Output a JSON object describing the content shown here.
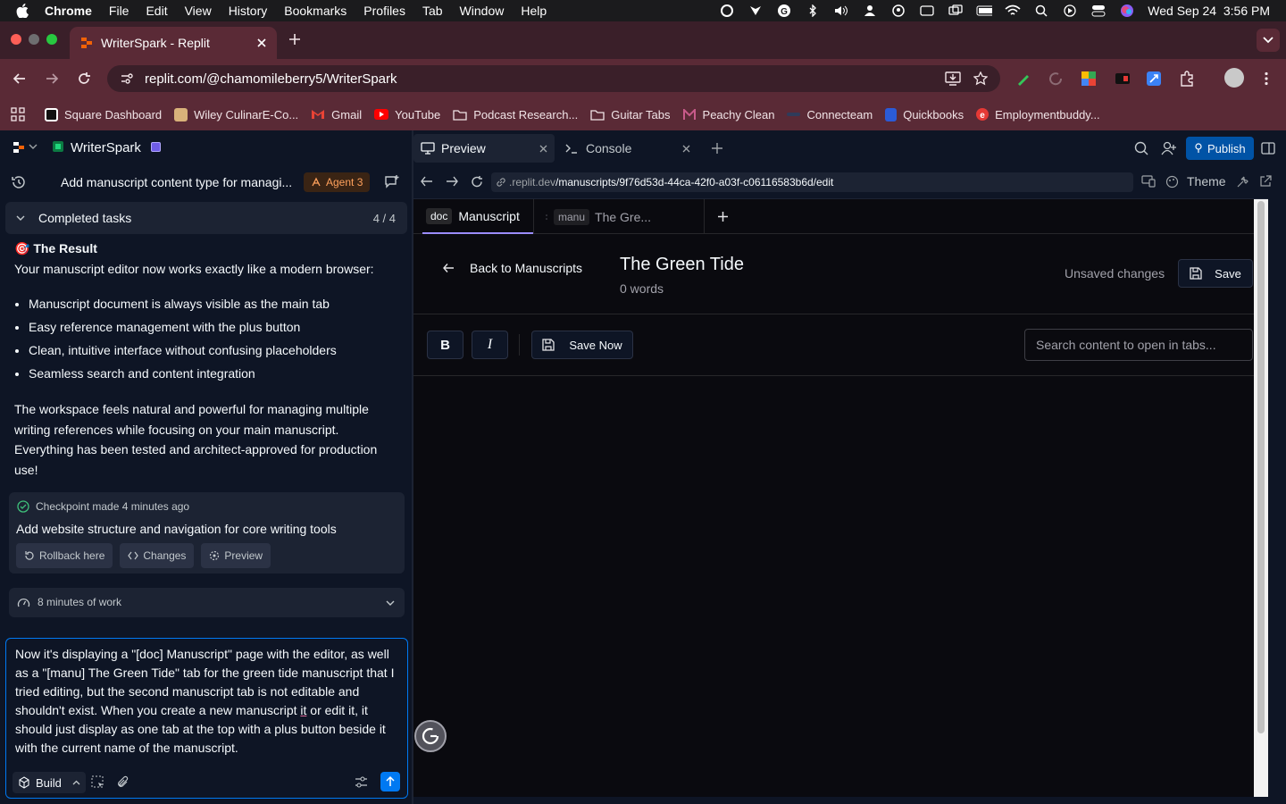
{
  "os_menu": {
    "app": "Chrome",
    "items": [
      "File",
      "Edit",
      "View",
      "History",
      "Bookmarks",
      "Profiles",
      "Tab",
      "Window",
      "Help"
    ],
    "clock": "Wed Sep 24  3:56 PM"
  },
  "browser": {
    "tab_title": "WriterSpark - Replit",
    "url": "replit.com/@chamomileberry5/WriterSpark",
    "bookmarks": [
      {
        "label": "Square Dashboard",
        "color": "#ffffff"
      },
      {
        "label": "Wiley CulinarE-Co...",
        "color": "#d9b27a"
      },
      {
        "label": "Gmail",
        "color": "#ea4335"
      },
      {
        "label": "YouTube",
        "color": "#ff0000"
      },
      {
        "label": "Podcast Research...",
        "color": "folder"
      },
      {
        "label": "Guitar Tabs",
        "color": "folder"
      },
      {
        "label": "Peachy Clean",
        "color": "#c85a8a"
      },
      {
        "label": "Connecteam",
        "color": "#2b6ed9"
      },
      {
        "label": "Quickbooks",
        "color": "#2b5bd7"
      },
      {
        "label": "Employmentbuddy...",
        "color": "#e53935"
      }
    ]
  },
  "replit": {
    "project": "WriterSpark",
    "thread_title": "Add manuscript content type for managi...",
    "agent_badge": "Agent 3",
    "tasks": {
      "label": "Completed tasks",
      "count": "4 / 4"
    },
    "result": {
      "heading": "🎯 The Result",
      "intro": "Your manuscript editor now works exactly like a modern browser:",
      "bullets": [
        "Manuscript document is always visible as the main tab",
        "Easy reference management with the plus button",
        "Clean, intuitive interface without confusing placeholders",
        "Seamless search and content integration"
      ],
      "summary": "The workspace feels natural and powerful for managing multiple writing references while focusing on your main manuscript. Everything has been tested and architect-approved for production use!"
    },
    "checkpoint": {
      "label": "Checkpoint made 4 minutes ago",
      "title": "Add website structure and navigation for core writing tools",
      "rollback": "Rollback here",
      "changes": "Changes",
      "preview": "Preview"
    },
    "work": {
      "label": "8 minutes of work"
    },
    "chat": {
      "t1": "Now it's displaying a \"[doc] Manuscript\" page with the editor, as well as a \"[manu] The Green Tide\" tab for the green tide manuscript that I tried editing, but the second manuscript tab is not editable and shouldn't exist. When you create a new manuscript ",
      "t2": "it",
      "t3": " or edit it, it should just display as one tab at the top with a plus button beside it with the current name of the manuscript.",
      "mode": "Build"
    },
    "panes": {
      "preview": "Preview",
      "console": "Console",
      "publish": "Publish"
    },
    "preview_bar": {
      "url_host": ".replit.dev",
      "url_path": "/manuscripts/9f76d53d-44ca-42f0-a03f-c06116583b6d/edit",
      "theme": "Theme"
    },
    "app": {
      "tab1_tag": "doc",
      "tab1_label": "Manuscript",
      "tab2_tag": "manu",
      "tab2_label": "The Gre...",
      "back": "Back to Manuscripts",
      "title": "The Green Tide",
      "words": "0 words",
      "unsaved": "Unsaved changes",
      "save": "Save",
      "bold": "B",
      "italic": "I",
      "save_now": "Save Now",
      "search_placeholder": "Search content to open in tabs..."
    }
  }
}
